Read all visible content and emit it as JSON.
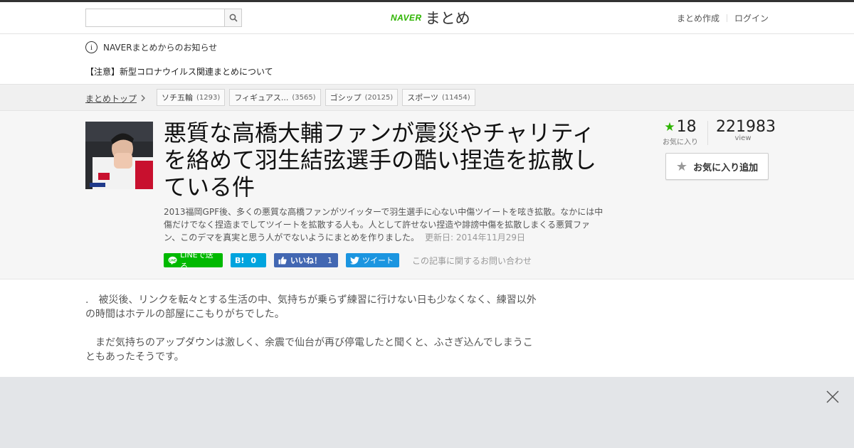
{
  "header": {
    "logo_brand": "NAVER",
    "logo_text": "まとめ",
    "search_placeholder": "",
    "links": {
      "create": "まとめ作成",
      "login": "ログイン"
    }
  },
  "notice": {
    "title": "NAVERまとめからのお知らせ",
    "link": "【注意】新型コロナウイルス関連まとめについて"
  },
  "breadcrumb": {
    "top": "まとめトップ",
    "tags": [
      {
        "label": "ソチ五輪",
        "count": "(1293)"
      },
      {
        "label": "フィギュアス...",
        "count": "(3565)"
      },
      {
        "label": "ゴシップ",
        "count": "(20125)"
      },
      {
        "label": "スポーツ",
        "count": "(11454)"
      }
    ]
  },
  "article": {
    "title": "悪質な高橋大輔ファンが震災やチャリティを絡めて羽生結弦選手の酷い捏造を拡散している件",
    "description": "2013福岡GPF後、多くの悪質な高橋ファンがツイッターで羽生選手に心ない中傷ツイートを呟き拡散。なかには中傷だけでなく捏造までしてツイートを拡散する人も。人として許せない捏造や誹謗中傷を拡散しまくる悪質ファン、このデマを真実と思う人がでないようにまとめを作りました。",
    "updated": "更新日: 2014年11月29日",
    "favorites": {
      "count": "18",
      "label": "お気に入り"
    },
    "views": {
      "count": "221983",
      "label": "view"
    },
    "fav_button": "お気に入り追加"
  },
  "share": {
    "line": "LINEで送る",
    "hatena_mark": "B!",
    "hatena_count": "0",
    "facebook": "いいね！",
    "facebook_count": "1",
    "twitter": "ツイート",
    "inquiry": "この記事に関するお問い合わせ"
  },
  "body": {
    "paragraphs": [
      ".　被災後、リンクを転々とする生活の中、気持ちが乗らず練習に行けない日も少なくなく、練習以外の時間はホテルの部屋にこもりがちでした。",
      "　まだ気持ちのアップダウンは激しく、余震で仙台が再び停電したと聞くと、ふさぎ込んでしまうこともあったそうです。"
    ]
  },
  "colors": {
    "accent": "#2db400",
    "line": "#00b900",
    "hatena": "#00a4de",
    "facebook": "#4267b2",
    "twitter": "#1b95e0"
  }
}
